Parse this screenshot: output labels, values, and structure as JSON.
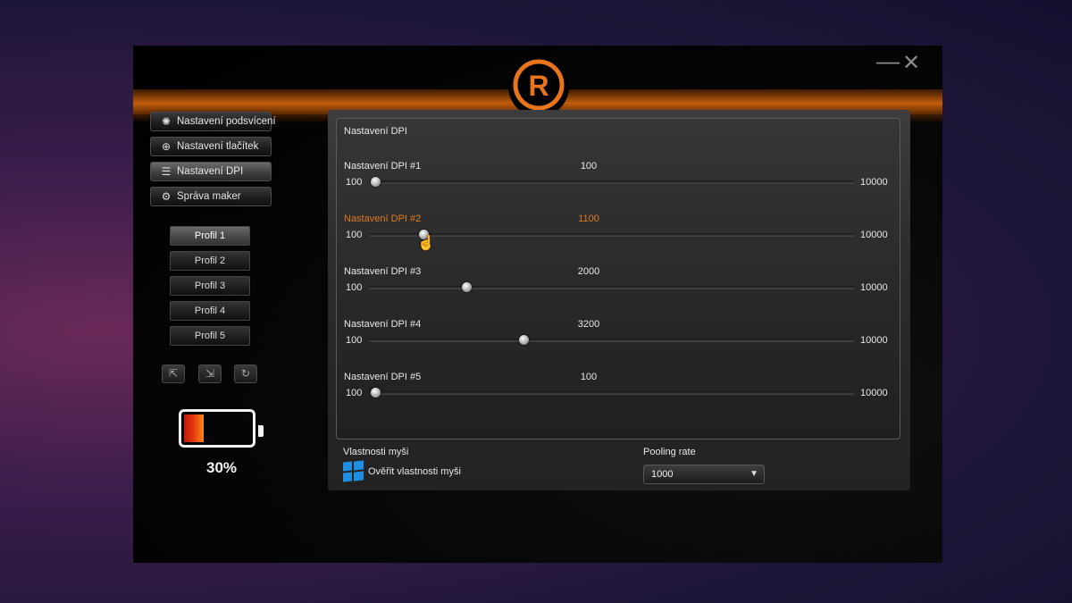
{
  "window": {
    "minimize_label": "—",
    "close_label": "✕",
    "logo_letter": "R"
  },
  "nav": [
    {
      "label": "Nastavení podsvícení",
      "icon": "sun-icon",
      "glyph": "✺"
    },
    {
      "label": "Nastavení tlačítek",
      "icon": "crosshair-icon",
      "glyph": "⊕"
    },
    {
      "label": "Nastavení DPI",
      "icon": "sliders-icon",
      "glyph": "☰"
    },
    {
      "label": "Správa maker",
      "icon": "gear-icon",
      "glyph": "⚙"
    }
  ],
  "profiles": [
    "Profil 1",
    "Profil 2",
    "Profil 3",
    "Profil 4",
    "Profil 5"
  ],
  "profile_tools": [
    {
      "icon": "export-icon",
      "glyph": "⇱"
    },
    {
      "icon": "import-icon",
      "glyph": "⇲"
    },
    {
      "icon": "reset-icon",
      "glyph": "↻"
    }
  ],
  "battery": {
    "level": 0.3,
    "text": "30%"
  },
  "dpi": {
    "title": "Nastavení DPI",
    "min": 100,
    "max": 10000,
    "rows": [
      {
        "label": "Nastavení DPI #1",
        "value": "100",
        "min_label": "100",
        "max_label": "10000"
      },
      {
        "label": "Nastavení DPI #2",
        "value": "1100",
        "min_label": "100",
        "max_label": "10000"
      },
      {
        "label": "Nastavení DPI #3",
        "value": "2000",
        "min_label": "100",
        "max_label": "10000"
      },
      {
        "label": "Nastavení DPI #4",
        "value": "3200",
        "min_label": "100",
        "max_label": "10000"
      },
      {
        "label": "Nastavení DPI #5",
        "value": "100",
        "min_label": "100",
        "max_label": "10000"
      }
    ]
  },
  "mouse": {
    "title": "Vlastnosti myši",
    "link": "Ověřit vlastnosti myši"
  },
  "polling": {
    "label": "Pooling rate",
    "selected": "1000",
    "arrow": "▼"
  },
  "colors": {
    "accent": "#e07a22",
    "brand_orange": "#c25d0a",
    "windows_blue": "#1e8fe0"
  }
}
